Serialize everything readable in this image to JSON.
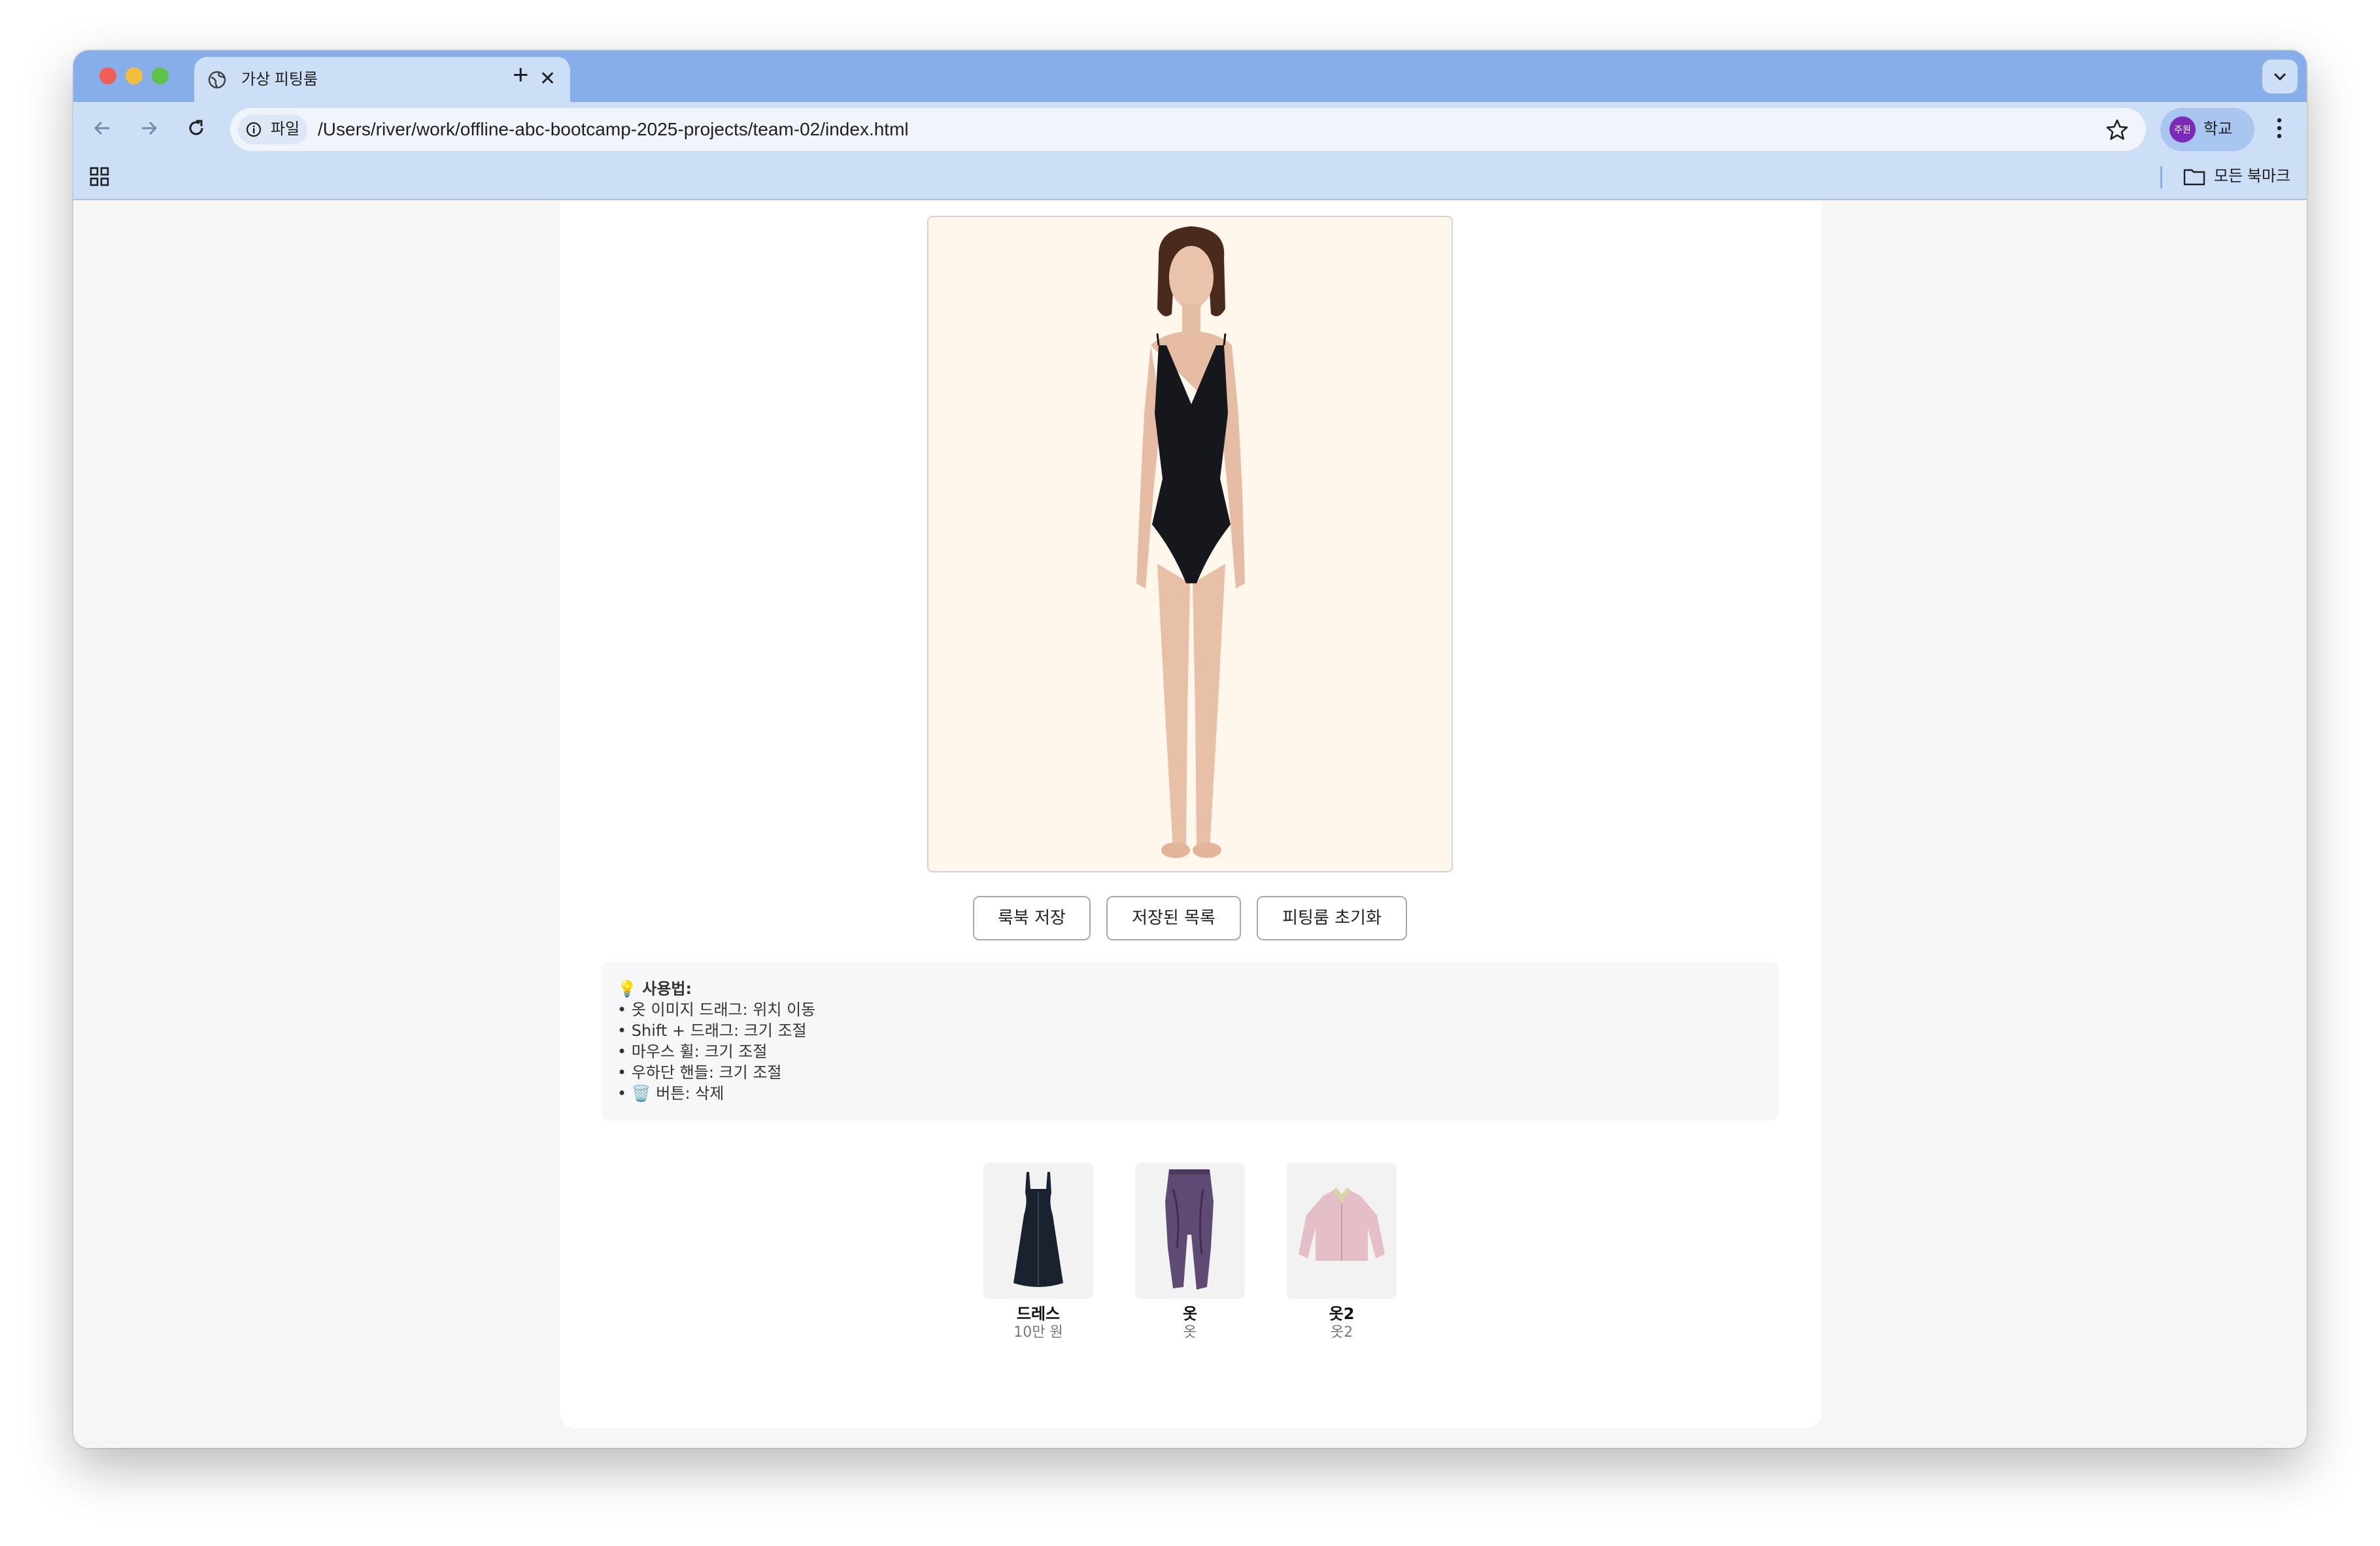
{
  "browser": {
    "tab_title": "가상 피팅룸",
    "tab_close": "✕",
    "new_tab": "+",
    "tab_list": "⌄",
    "site_chip": "파일",
    "url": "/Users/river/work/offline-abc-bootcamp-2025-projects/team-02/index.html",
    "profile_avatar": "주원",
    "profile_label": "학교",
    "bookmarks_all": "모든 북마크"
  },
  "page": {
    "buttons": {
      "save_lookbook": "룩북 저장",
      "saved_list": "저장된 목록",
      "reset_fitting": "피팅룸 초기화"
    },
    "help": {
      "title": "💡 사용법:",
      "lines": [
        "• 옷 이미지 드래그: 위치 이동",
        "• Shift + 드래그: 크기 조절",
        "• 마우스 휠: 크기 조절",
        "• 우하단 핸들: 크기 조절",
        "• 🗑️ 버튼: 삭제"
      ]
    },
    "items": [
      {
        "name": "드레스",
        "price": "10만 원",
        "icon": "dress-thumbnail"
      },
      {
        "name": "옷",
        "price": "옷",
        "icon": "pants-thumbnail"
      },
      {
        "name": "옷2",
        "price": "옷2",
        "icon": "jacket-thumbnail"
      }
    ]
  },
  "colors": {
    "tab_strip": "#87aee9",
    "toolbar": "#cddff7",
    "stage_bg": "#fff7ec",
    "page_bg": "#f6f6f6"
  }
}
